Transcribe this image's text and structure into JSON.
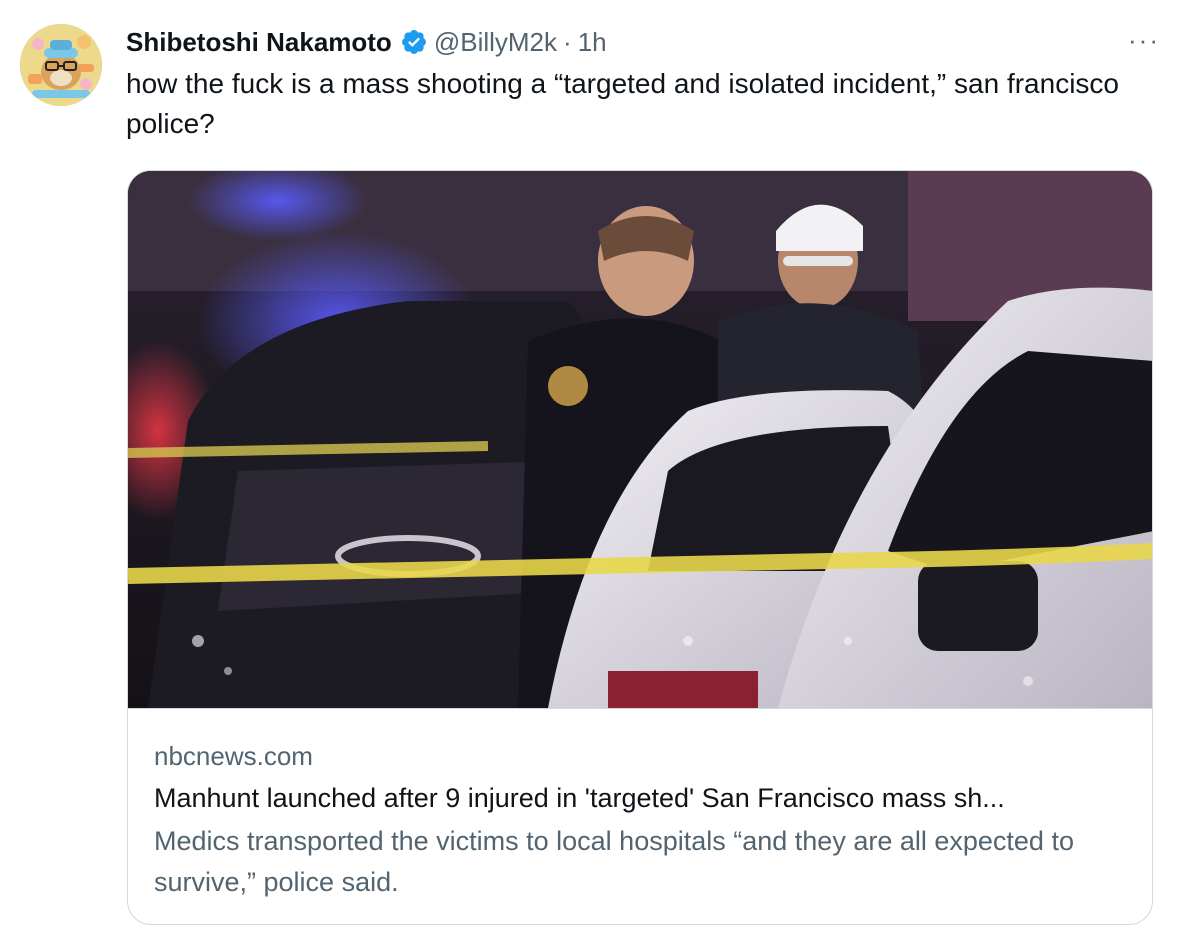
{
  "tweet": {
    "display_name": "Shibetoshi Nakamoto",
    "handle": "@BillyM2k",
    "separator": "·",
    "time": "1h",
    "more_label": "···",
    "text": "how the fuck is a mass shooting a “targeted and isolated incident,” san francisco police?"
  },
  "card": {
    "domain": "nbcnews.com",
    "headline": "Manhunt launched after 9 injured in 'targeted' San Francisco mass sh...",
    "description": "Medics transported the victims to local hospitals “and they are all expected to survive,” police said."
  },
  "icons": {
    "verified": "verified-badge-icon",
    "more": "more-options-icon"
  },
  "colors": {
    "verified_blue": "#1d9bf0",
    "secondary_text": "#536471",
    "border": "#cfd9de"
  }
}
